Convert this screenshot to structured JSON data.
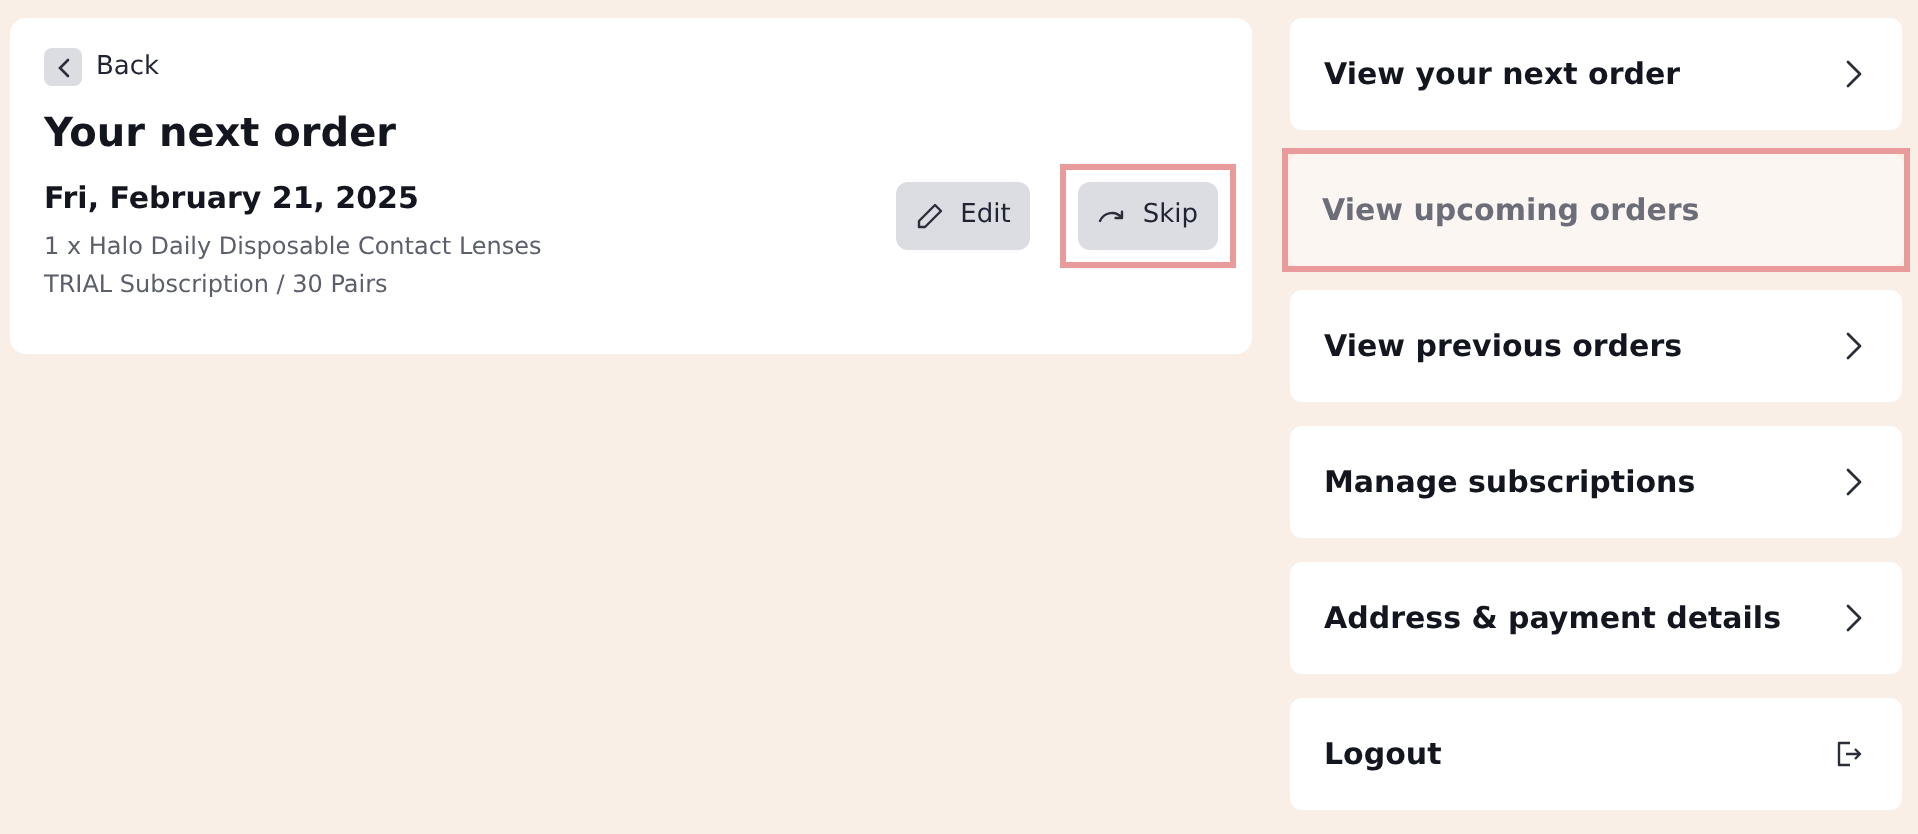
{
  "back_link": {
    "label": "Back"
  },
  "order": {
    "title": "Your next order",
    "date": "Fri, February 21, 2025",
    "lines": [
      "1 x Halo Daily Disposable Contact Lenses",
      "TRIAL Subscription / 30 Pairs"
    ],
    "actions": [
      {
        "kind": "edit",
        "label": "Edit",
        "highlighted": false
      },
      {
        "kind": "skip",
        "label": "Skip",
        "highlighted": true
      }
    ]
  },
  "menu": [
    {
      "label": "View your next order",
      "kind": "chevron",
      "selected": false,
      "highlighted": false
    },
    {
      "label": "View upcoming orders",
      "selected": true,
      "highlighted": true
    },
    {
      "label": "View previous orders",
      "kind": "chevron",
      "selected": false,
      "highlighted": false
    },
    {
      "label": "Manage subscriptions",
      "kind": "chevron",
      "selected": false,
      "highlighted": false
    },
    {
      "label": "Address & payment details",
      "kind": "chevron",
      "selected": false,
      "highlighted": false
    },
    {
      "label": "Logout",
      "kind": "logout",
      "selected": false,
      "highlighted": false
    }
  ]
}
